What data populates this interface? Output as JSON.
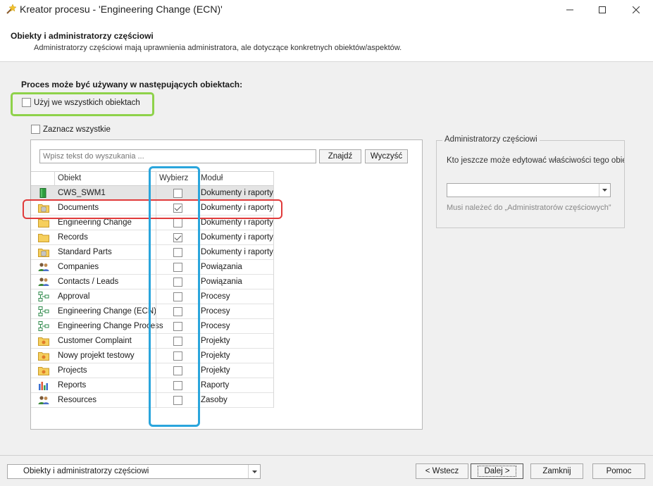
{
  "window": {
    "title": "Kreator procesu - 'Engineering Change (ECN)'"
  },
  "header": {
    "title": "Obiekty i administratorzy częściowi",
    "subtitle": "Administratorzy częściowi mają uprawnienia administratora, ale dotyczące konkretnych obiektów/aspektów."
  },
  "main": {
    "section_label": "Proces może być używany w następujących obiektach:",
    "use_all_label": "Użyj we wszystkich obiektach",
    "select_all_label": "Zaznacz wszystkie",
    "search_placeholder": "Wpisz tekst do wyszukania ...",
    "find_label": "Znajdź",
    "clear_label": "Wyczyść",
    "columns": {
      "object": "Obiekt",
      "select": "Wybierz",
      "module": "Moduł"
    },
    "rows": [
      {
        "name": "CWS_SWM1",
        "icon": "green-book-icon",
        "checked": false,
        "module": "Dokumenty i raporty"
      },
      {
        "name": "Documents",
        "icon": "folder-doc-icon",
        "checked": true,
        "module": "Dokumenty i raporty"
      },
      {
        "name": "Engineering Change",
        "icon": "folder-icon",
        "checked": false,
        "module": "Dokumenty i raporty"
      },
      {
        "name": "Records",
        "icon": "folder-icon",
        "checked": true,
        "module": "Dokumenty i raporty"
      },
      {
        "name": "Standard Parts",
        "icon": "folder-doc-icon",
        "checked": false,
        "module": "Dokumenty i raporty"
      },
      {
        "name": "Companies",
        "icon": "people-icon",
        "checked": false,
        "module": "Powiązania"
      },
      {
        "name": "Contacts / Leads",
        "icon": "people-icon",
        "checked": false,
        "module": "Powiązania"
      },
      {
        "name": "Approval",
        "icon": "process-icon",
        "checked": false,
        "module": "Procesy"
      },
      {
        "name": "Engineering Change (ECN)",
        "icon": "process-icon",
        "checked": false,
        "module": "Procesy"
      },
      {
        "name": "Engineering Change Process",
        "icon": "process-icon",
        "checked": false,
        "module": "Procesy"
      },
      {
        "name": "Customer Complaint",
        "icon": "project-folder-icon",
        "checked": false,
        "module": "Projekty"
      },
      {
        "name": "Nowy projekt testowy",
        "icon": "project-folder-icon",
        "checked": false,
        "module": "Projekty"
      },
      {
        "name": "Projects",
        "icon": "project-folder-icon",
        "checked": false,
        "module": "Projekty"
      },
      {
        "name": "Reports",
        "icon": "bar-chart-icon",
        "checked": false,
        "module": "Raporty"
      },
      {
        "name": "Resources",
        "icon": "people-icon",
        "checked": false,
        "module": "Zasoby"
      }
    ]
  },
  "admins": {
    "legend": "Administratorzy częściowi",
    "question": "Kto jeszcze może edytować właściwości tego obiektu",
    "combo_value": "",
    "hint": "Musi należeć do „Administratorów częściowych”"
  },
  "footer": {
    "step_value": "Obiekty i administratorzy częściowi",
    "back_label": "< Wstecz",
    "next_label": "Dalej >",
    "close_label": "Zamknij",
    "help_label": "Pomoc"
  },
  "colors": {
    "highlight_green": "#8ed24a",
    "highlight_red": "#e03b3b",
    "highlight_blue": "#2aa5dc"
  }
}
